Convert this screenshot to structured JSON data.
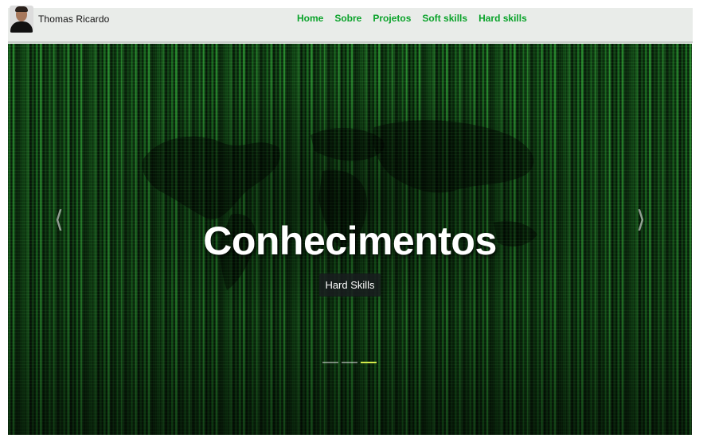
{
  "brand": {
    "name": "Thomas Ricardo"
  },
  "nav": {
    "items": [
      {
        "label": "Home"
      },
      {
        "label": "Sobre"
      },
      {
        "label": "Projetos"
      },
      {
        "label": "Soft skills"
      },
      {
        "label": "Hard skills"
      }
    ]
  },
  "carousel": {
    "title": "Conhecimentos",
    "subtitle": "Hard Skills",
    "prev_icon": "chevron-left-icon",
    "next_icon": "chevron-right-icon",
    "slide_count": 3,
    "active_index": 2
  },
  "colors": {
    "nav_link": "#0aa32a",
    "active_indicator": "#d3e84a",
    "hero_green": "#1e7a25"
  }
}
